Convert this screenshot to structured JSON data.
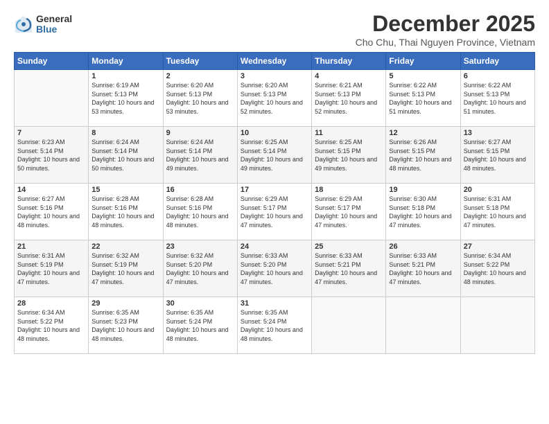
{
  "header": {
    "logo_general": "General",
    "logo_blue": "Blue",
    "month_title": "December 2025",
    "subtitle": "Cho Chu, Thai Nguyen Province, Vietnam"
  },
  "calendar": {
    "days_of_week": [
      "Sunday",
      "Monday",
      "Tuesday",
      "Wednesday",
      "Thursday",
      "Friday",
      "Saturday"
    ],
    "weeks": [
      [
        {
          "day": "",
          "info": ""
        },
        {
          "day": "1",
          "info": "Sunrise: 6:19 AM\nSunset: 5:13 PM\nDaylight: 10 hours\nand 53 minutes."
        },
        {
          "day": "2",
          "info": "Sunrise: 6:20 AM\nSunset: 5:13 PM\nDaylight: 10 hours\nand 53 minutes."
        },
        {
          "day": "3",
          "info": "Sunrise: 6:20 AM\nSunset: 5:13 PM\nDaylight: 10 hours\nand 52 minutes."
        },
        {
          "day": "4",
          "info": "Sunrise: 6:21 AM\nSunset: 5:13 PM\nDaylight: 10 hours\nand 52 minutes."
        },
        {
          "day": "5",
          "info": "Sunrise: 6:22 AM\nSunset: 5:13 PM\nDaylight: 10 hours\nand 51 minutes."
        },
        {
          "day": "6",
          "info": "Sunrise: 6:22 AM\nSunset: 5:13 PM\nDaylight: 10 hours\nand 51 minutes."
        }
      ],
      [
        {
          "day": "7",
          "info": "Sunrise: 6:23 AM\nSunset: 5:14 PM\nDaylight: 10 hours\nand 50 minutes."
        },
        {
          "day": "8",
          "info": "Sunrise: 6:24 AM\nSunset: 5:14 PM\nDaylight: 10 hours\nand 50 minutes."
        },
        {
          "day": "9",
          "info": "Sunrise: 6:24 AM\nSunset: 5:14 PM\nDaylight: 10 hours\nand 49 minutes."
        },
        {
          "day": "10",
          "info": "Sunrise: 6:25 AM\nSunset: 5:14 PM\nDaylight: 10 hours\nand 49 minutes."
        },
        {
          "day": "11",
          "info": "Sunrise: 6:25 AM\nSunset: 5:15 PM\nDaylight: 10 hours\nand 49 minutes."
        },
        {
          "day": "12",
          "info": "Sunrise: 6:26 AM\nSunset: 5:15 PM\nDaylight: 10 hours\nand 48 minutes."
        },
        {
          "day": "13",
          "info": "Sunrise: 6:27 AM\nSunset: 5:15 PM\nDaylight: 10 hours\nand 48 minutes."
        }
      ],
      [
        {
          "day": "14",
          "info": "Sunrise: 6:27 AM\nSunset: 5:16 PM\nDaylight: 10 hours\nand 48 minutes."
        },
        {
          "day": "15",
          "info": "Sunrise: 6:28 AM\nSunset: 5:16 PM\nDaylight: 10 hours\nand 48 minutes."
        },
        {
          "day": "16",
          "info": "Sunrise: 6:28 AM\nSunset: 5:16 PM\nDaylight: 10 hours\nand 48 minutes."
        },
        {
          "day": "17",
          "info": "Sunrise: 6:29 AM\nSunset: 5:17 PM\nDaylight: 10 hours\nand 47 minutes."
        },
        {
          "day": "18",
          "info": "Sunrise: 6:29 AM\nSunset: 5:17 PM\nDaylight: 10 hours\nand 47 minutes."
        },
        {
          "day": "19",
          "info": "Sunrise: 6:30 AM\nSunset: 5:18 PM\nDaylight: 10 hours\nand 47 minutes."
        },
        {
          "day": "20",
          "info": "Sunrise: 6:31 AM\nSunset: 5:18 PM\nDaylight: 10 hours\nand 47 minutes."
        }
      ],
      [
        {
          "day": "21",
          "info": "Sunrise: 6:31 AM\nSunset: 5:19 PM\nDaylight: 10 hours\nand 47 minutes."
        },
        {
          "day": "22",
          "info": "Sunrise: 6:32 AM\nSunset: 5:19 PM\nDaylight: 10 hours\nand 47 minutes."
        },
        {
          "day": "23",
          "info": "Sunrise: 6:32 AM\nSunset: 5:20 PM\nDaylight: 10 hours\nand 47 minutes."
        },
        {
          "day": "24",
          "info": "Sunrise: 6:33 AM\nSunset: 5:20 PM\nDaylight: 10 hours\nand 47 minutes."
        },
        {
          "day": "25",
          "info": "Sunrise: 6:33 AM\nSunset: 5:21 PM\nDaylight: 10 hours\nand 47 minutes."
        },
        {
          "day": "26",
          "info": "Sunrise: 6:33 AM\nSunset: 5:21 PM\nDaylight: 10 hours\nand 47 minutes."
        },
        {
          "day": "27",
          "info": "Sunrise: 6:34 AM\nSunset: 5:22 PM\nDaylight: 10 hours\nand 48 minutes."
        }
      ],
      [
        {
          "day": "28",
          "info": "Sunrise: 6:34 AM\nSunset: 5:22 PM\nDaylight: 10 hours\nand 48 minutes."
        },
        {
          "day": "29",
          "info": "Sunrise: 6:35 AM\nSunset: 5:23 PM\nDaylight: 10 hours\nand 48 minutes."
        },
        {
          "day": "30",
          "info": "Sunrise: 6:35 AM\nSunset: 5:24 PM\nDaylight: 10 hours\nand 48 minutes."
        },
        {
          "day": "31",
          "info": "Sunrise: 6:35 AM\nSunset: 5:24 PM\nDaylight: 10 hours\nand 48 minutes."
        },
        {
          "day": "",
          "info": ""
        },
        {
          "day": "",
          "info": ""
        },
        {
          "day": "",
          "info": ""
        }
      ]
    ]
  }
}
